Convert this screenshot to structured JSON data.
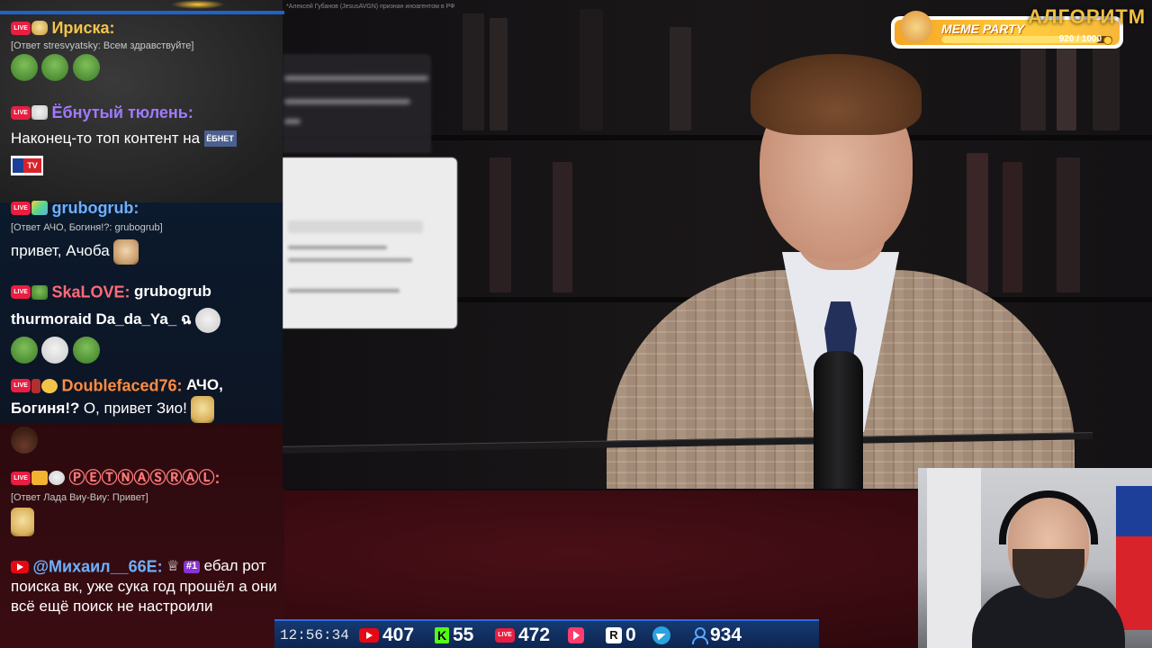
{
  "video": {
    "notice": "*Алексей Губанов (JesusAVGN) признан иноагентом в РФ"
  },
  "widgets": {
    "meme_party": {
      "title": "MEME PARTY",
      "count": "920 / 1000",
      "progress": 0.92
    },
    "algo_text": "АЛГОРИТМ"
  },
  "chat": {
    "messages": [
      {
        "nick": "Ириска:",
        "nick_color": "#f2c44a",
        "reply": "[Ответ stresvyatsky: Всем здравствуйте]",
        "emotes": [
          "frog",
          "frog",
          "frog"
        ]
      },
      {
        "nick": "Ёбнутый тюлень:",
        "nick_color": "#a07aff",
        "text": "Наконец-то топ контент на",
        "ebnet": "ЁБНЕТ",
        "mtv": "TV"
      },
      {
        "nick": "grubogrub:",
        "nick_color": "#6fb0ff",
        "reply": "[Ответ АЧО, Богиня!?: grubogrub]",
        "text": "привет, Ачоба"
      },
      {
        "nick": "SkaLOVE:",
        "nick_color": "#ff6a7a",
        "mention": "grubogrub",
        "text": "thurmoraid Da_da_Ya_ ฉ"
      },
      {
        "nick": "Doublefaced76:",
        "nick_color": "#ff8c42",
        "text_bold": "АЧО, Богиня!?",
        "text": "О, привет Зио!"
      },
      {
        "nick": "ⓅⒺⓉⓃⒶⓈⓇⒶⓁ:",
        "nick_color": "#ff7a7a",
        "reply": "[Ответ Лада Виу-Виу: Привет]"
      },
      {
        "nick": "@Михаил__66E:",
        "nick_color": "#6fb0ff",
        "crown": "♕",
        "rank": "#1",
        "text": "ебал рот поиска вк, уже сука год прошёл а они всё ещё поиск не настроили"
      }
    ]
  },
  "bottom_bar": {
    "time": "12:56:34",
    "youtube": "407",
    "kick": "55",
    "vk": "472",
    "rutube": "0",
    "total": "934",
    "kick_letter": "K",
    "r_letter": "R"
  },
  "colors": {
    "vk_red": "#e91e41",
    "youtube_red": "#e50914",
    "kick_green": "#53fc18",
    "telegram_blue": "#2aa3df"
  }
}
